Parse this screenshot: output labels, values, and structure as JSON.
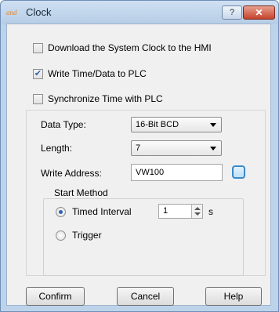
{
  "window": {
    "title": "Clock",
    "app_icon_text": "and",
    "help_button": "?",
    "close_button": "✕"
  },
  "checkboxes": [
    {
      "label": "Download the System Clock to the HMI",
      "checked": false
    },
    {
      "label": "Write Time/Data to PLC",
      "checked": true
    },
    {
      "label": "Synchronize Time with PLC",
      "checked": false
    }
  ],
  "settings": {
    "data_type_label": "Data Type:",
    "data_type_value": "16-Bit BCD",
    "length_label": "Length:",
    "length_value": "7",
    "write_address_label": "Write Address:",
    "write_address_value": "VW100"
  },
  "start_method": {
    "legend": "Start Method",
    "timed_interval_label": "Timed Interval",
    "timed_interval_selected": true,
    "interval_value": "1",
    "interval_unit": "s",
    "trigger_label": "Trigger",
    "trigger_selected": false
  },
  "buttons": {
    "confirm": "Confirm",
    "cancel": "Cancel",
    "help": "Help"
  },
  "colors": {
    "title_bar": "#bcd3ea",
    "dialog_background": "#f0f0f0",
    "close_button": "#c6432c",
    "check_and_radio_accent": "#2c62b5"
  }
}
